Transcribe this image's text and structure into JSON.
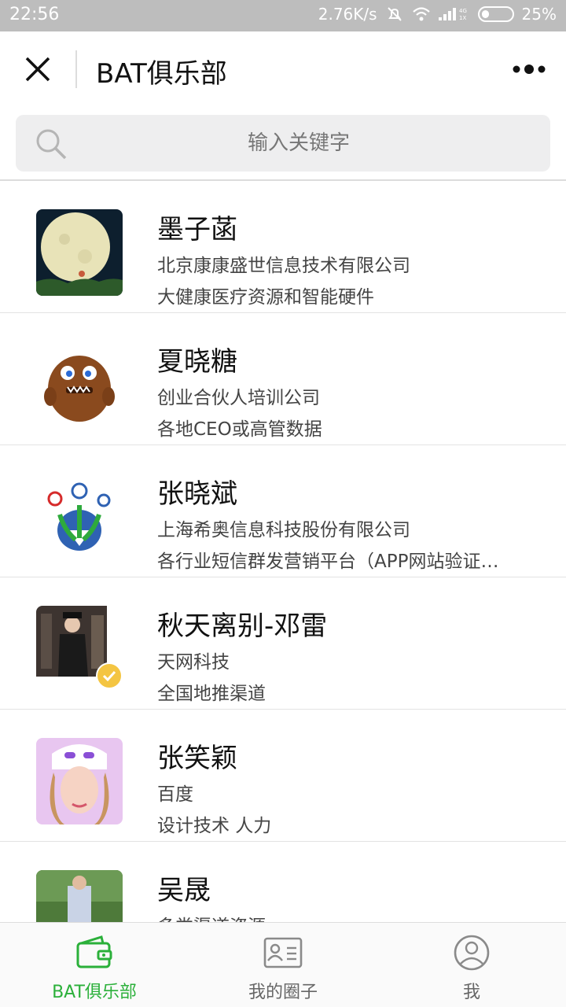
{
  "status_bar": {
    "time": "22:56",
    "network_speed": "2.76K/s",
    "signal_label_top": "4G",
    "signal_label_bottom": "1X",
    "battery": "25%",
    "battery_level": 0.25
  },
  "header": {
    "title": "BAT俱乐部",
    "close_icon": "close-icon",
    "more_icon": "more-icon"
  },
  "search": {
    "placeholder": "输入关键字"
  },
  "members": [
    {
      "name": "墨子菡",
      "company": "北京康康盛世信息技术有限公司",
      "description": "大健康医疗资源和智能硬件",
      "avatar": "moon-avatar"
    },
    {
      "name": "夏晓糖",
      "company": "创业合伙人培训公司",
      "description": "各地CEO或高管数据",
      "avatar": "monster-avatar"
    },
    {
      "name": "张晓斌",
      "company": "上海希奥信息科技股份有限公司",
      "description": "各行业短信群发营销平台（APP网站验证…",
      "avatar": "logo-avatar"
    },
    {
      "name": "秋天离别-邓雷",
      "company": "天网科技",
      "description": "全国地推渠道",
      "avatar": "photo-avatar",
      "verified": true
    },
    {
      "name": "张笑颖",
      "company": "百度",
      "description": "设计技术 人力",
      "avatar": "selfie-avatar"
    },
    {
      "name": "吴晟",
      "company": "多类渠道资源",
      "description": "",
      "avatar": "outdoor-avatar"
    }
  ],
  "bottom_nav": [
    {
      "label": "BAT俱乐部",
      "icon": "wallet-icon",
      "active": true
    },
    {
      "label": "我的圈子",
      "icon": "contact-card-icon",
      "active": false
    },
    {
      "label": "我",
      "icon": "user-icon",
      "active": false
    }
  ],
  "colors": {
    "accent": "#2bb03a",
    "status_bar": "#bdbdbd",
    "search_bg": "#eeeeef"
  }
}
